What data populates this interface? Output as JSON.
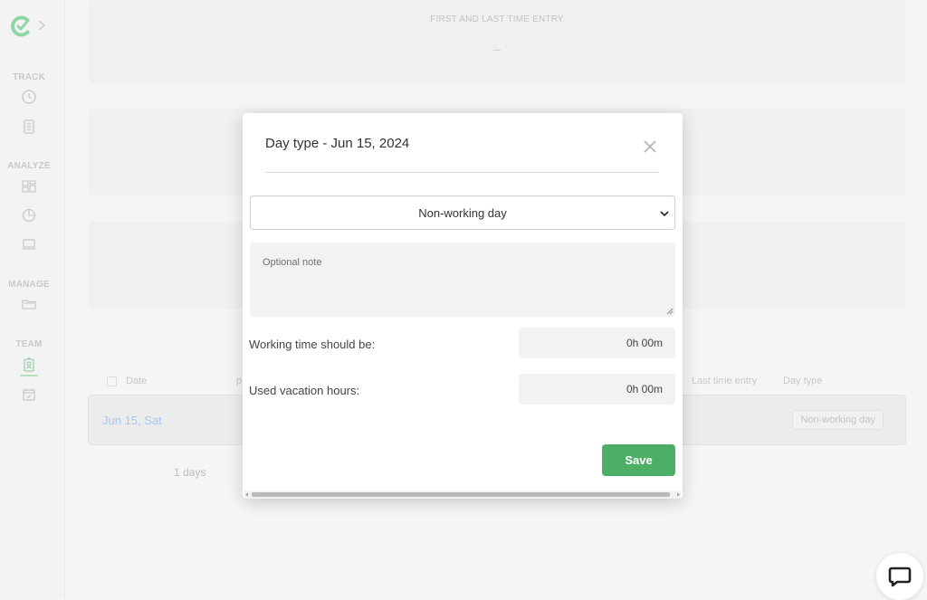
{
  "colors": {
    "brand_green": "#4caf65",
    "link_blue": "#a9c6f0",
    "modal_bg": "#ffffff"
  },
  "sidebar": {
    "sections": [
      {
        "label": "TRACK",
        "items": [
          "clock-icon",
          "timesheet-icon"
        ]
      },
      {
        "label": "ANALYZE",
        "items": [
          "dashboard-icon",
          "reports-icon",
          "activity-icon"
        ]
      },
      {
        "label": "MANAGE",
        "items": [
          "projects-folder-icon"
        ]
      },
      {
        "label": "TEAM",
        "items": [
          "team-badge-icon",
          "calendar-icon"
        ]
      }
    ]
  },
  "background": {
    "card_title": "FIRST AND LAST TIME ENTRY",
    "card_value": "–",
    "table_headers": {
      "date": "Date",
      "partial": "p",
      "last_entry": "Last time entry",
      "day_type": "Day type"
    },
    "row": {
      "date": "Jun 15, Sat",
      "day_type": "Non-working day"
    },
    "days_total": "1 days"
  },
  "modal": {
    "title": "Day type - Jun 15, 2024",
    "select_value": "Non-working day",
    "note_placeholder": "Optional note",
    "working_time_label": "Working time should be:",
    "working_time_value": "0h 00m",
    "vacation_label": "Used vacation hours:",
    "vacation_value": "0h 00m",
    "save_label": "Save"
  }
}
